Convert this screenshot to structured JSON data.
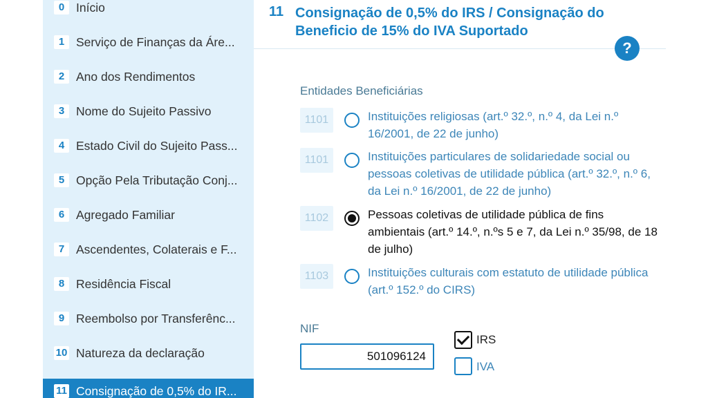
{
  "sidebar": {
    "items": [
      {
        "num": "0",
        "label": "Início"
      },
      {
        "num": "1",
        "label": "Serviço de Finanças da Áre..."
      },
      {
        "num": "2",
        "label": "Ano dos Rendimentos"
      },
      {
        "num": "3",
        "label": "Nome do Sujeito Passivo"
      },
      {
        "num": "4",
        "label": "Estado Civil do Sujeito Pass..."
      },
      {
        "num": "5",
        "label": "Opção Pela Tributação Conj..."
      },
      {
        "num": "6",
        "label": "Agregado Familiar"
      },
      {
        "num": "7",
        "label": "Ascendentes, Colaterais e F..."
      },
      {
        "num": "8",
        "label": "Residência Fiscal"
      },
      {
        "num": "9",
        "label": "Reembolso por Transferênc..."
      },
      {
        "num": "10",
        "label": "Natureza da declaração"
      },
      {
        "num": "11",
        "label": "Consignação de 0,5% do IR..."
      }
    ],
    "active_index": 11
  },
  "section": {
    "number": "11",
    "title": "Consignação de 0,5% do IRS / Consignação do Beneficio de 15% do IVA Suportado",
    "help_label": "?"
  },
  "beneficiaries": {
    "label": "Entidades Beneficiárias",
    "options": [
      {
        "code": "1101",
        "text": "Instituições religiosas (art.º 32.º, n.º 4, da Lei n.º 16/2001, de 22 de junho)",
        "selected": false
      },
      {
        "code": "1101",
        "text": "Instituições particulares de solidariedade social ou pessoas coletivas de utilidade pública (art.º 32.º, n.º 6, da Lei n.º 16/2001, de 22 de junho)",
        "selected": false
      },
      {
        "code": "1102",
        "text": "Pessoas coletivas de utilidade pública de fins ambientais (art.º 14.º, n.ºs 5 e 7, da Lei n.º 35/98, de 18 de julho)",
        "selected": true
      },
      {
        "code": "1103",
        "text": "Instituições culturais com estatuto de utilidade pública (art.º 152.º do CIRS)",
        "selected": false
      }
    ]
  },
  "nif": {
    "label": "NIF",
    "value": "501096124"
  },
  "checks": {
    "irs": {
      "label": "IRS",
      "checked": true
    },
    "iva": {
      "label": "IVA",
      "checked": false
    }
  },
  "colors": {
    "accent": "#1a82c4",
    "sidebar_bg": "#e1f1fb"
  }
}
